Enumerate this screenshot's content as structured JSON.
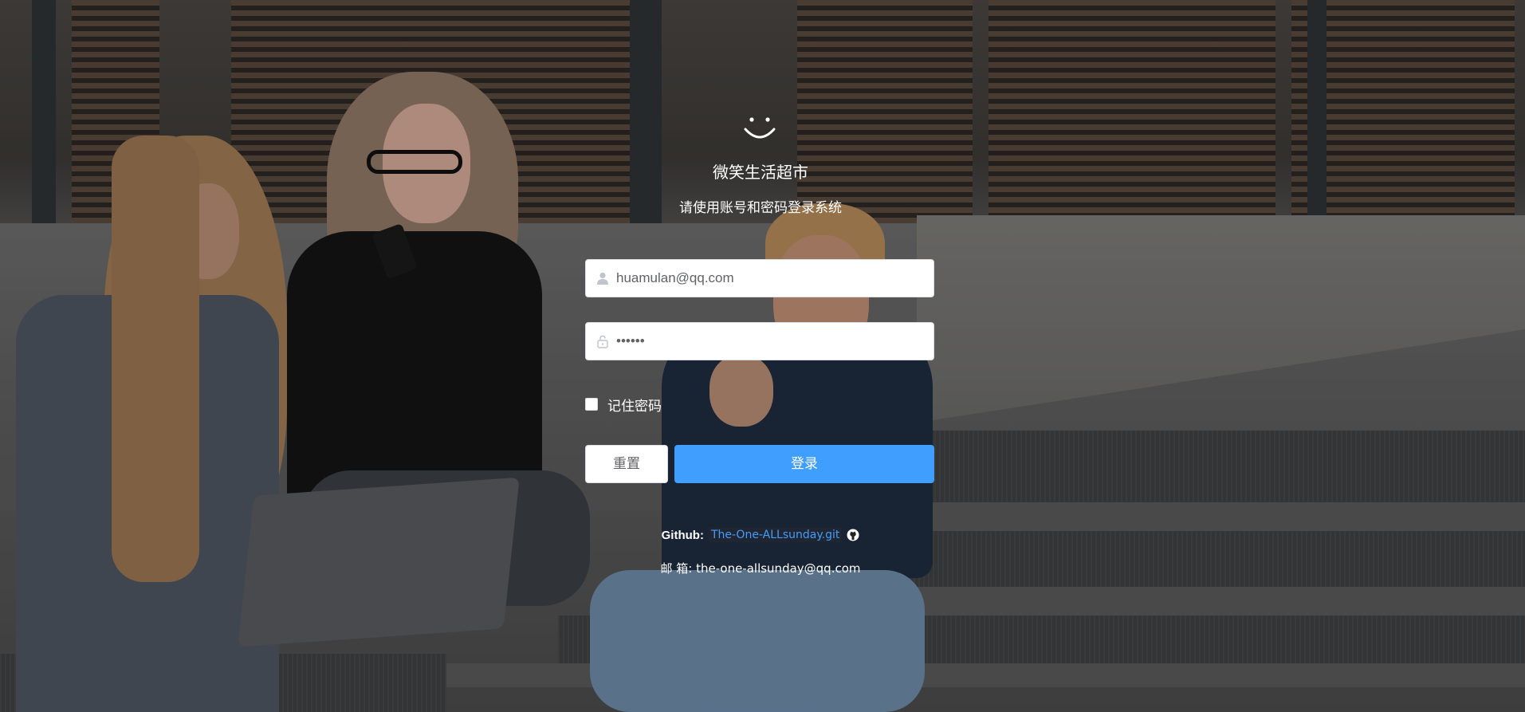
{
  "brand": {
    "logo_icon": "smiley-icon",
    "title": "微笑生活超市",
    "subtitle": "请使用账号和密码登录系统"
  },
  "form": {
    "username": {
      "icon": "user-icon",
      "value": "huamulan@qq.com",
      "placeholder": ""
    },
    "password": {
      "icon": "lock-icon",
      "value": "••••••",
      "placeholder": ""
    },
    "remember_label": "记住密码",
    "remember_checked": false,
    "reset_label": "重置",
    "login_label": "登录"
  },
  "footer": {
    "github_label": "Github:",
    "github_link": "The-One-ALLsunday.git",
    "github_icon": "github-icon",
    "mail_label": "邮 箱:",
    "mail_value": "the-one-allsunday@qq.com"
  },
  "colors": {
    "primary": "#409eff",
    "white": "#ffffff",
    "border": "#dcdfe6"
  }
}
